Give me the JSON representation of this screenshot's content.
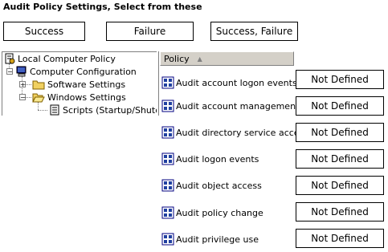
{
  "title": "Audit Policy Settings, Select from these",
  "buttons": {
    "success": "Success",
    "failure": "Failure",
    "success_failure": "Success, Failure"
  },
  "tree": {
    "items": [
      {
        "label": "Local Computer Policy",
        "icon": "policy-icon"
      },
      {
        "label": "Computer Configuration",
        "icon": "computer-icon"
      },
      {
        "label": "Software Settings",
        "icon": "folder-icon"
      },
      {
        "label": "Windows Settings",
        "icon": "folder-open-icon"
      },
      {
        "label": "Scripts (Startup/Shutdown)",
        "icon": "scripts-icon"
      }
    ]
  },
  "list": {
    "column_header": "Policy",
    "rows": [
      {
        "label": "Audit account logon events",
        "value": "Not Defined"
      },
      {
        "label": "Audit account management",
        "value": "Not Defined"
      },
      {
        "label": "Audit directory service access",
        "value": "Not Defined"
      },
      {
        "label": "Audit logon events",
        "value": "Not Defined"
      },
      {
        "label": "Audit object access",
        "value": "Not Defined"
      },
      {
        "label": "Audit policy change",
        "value": "Not Defined"
      },
      {
        "label": "Audit privilege use",
        "value": "Not Defined"
      }
    ]
  }
}
